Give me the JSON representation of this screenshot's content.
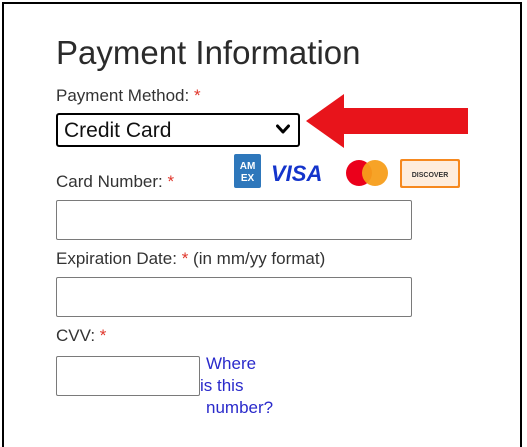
{
  "form": {
    "title": "Payment Information",
    "required_marker": "*",
    "payment_method": {
      "label": "Payment Method:",
      "selected": "Credit Card"
    },
    "card_number": {
      "label": "Card Number:",
      "value": "",
      "accepted_cards": [
        "amex-icon",
        "visa-icon",
        "mastercard-icon",
        "discover-icon"
      ],
      "visa_text": "VISA",
      "amex_text": "AM EX",
      "discover_text": "DISCOVER"
    },
    "expiration": {
      "label": "Expiration Date:",
      "hint": "(in mm/yy format)",
      "value": ""
    },
    "cvv": {
      "label": "CVV:",
      "value": "",
      "help_link": [
        "Where",
        "is this",
        "number?"
      ]
    }
  },
  "colors": {
    "required": "#e0362b",
    "arrow": "#e8141b",
    "link": "#2a2acb",
    "visa": "#1434cb",
    "amex": "#2e77bb",
    "mc_red": "#eb001b",
    "mc_orange": "#f79e1b",
    "discover_orange": "#f6891f"
  }
}
